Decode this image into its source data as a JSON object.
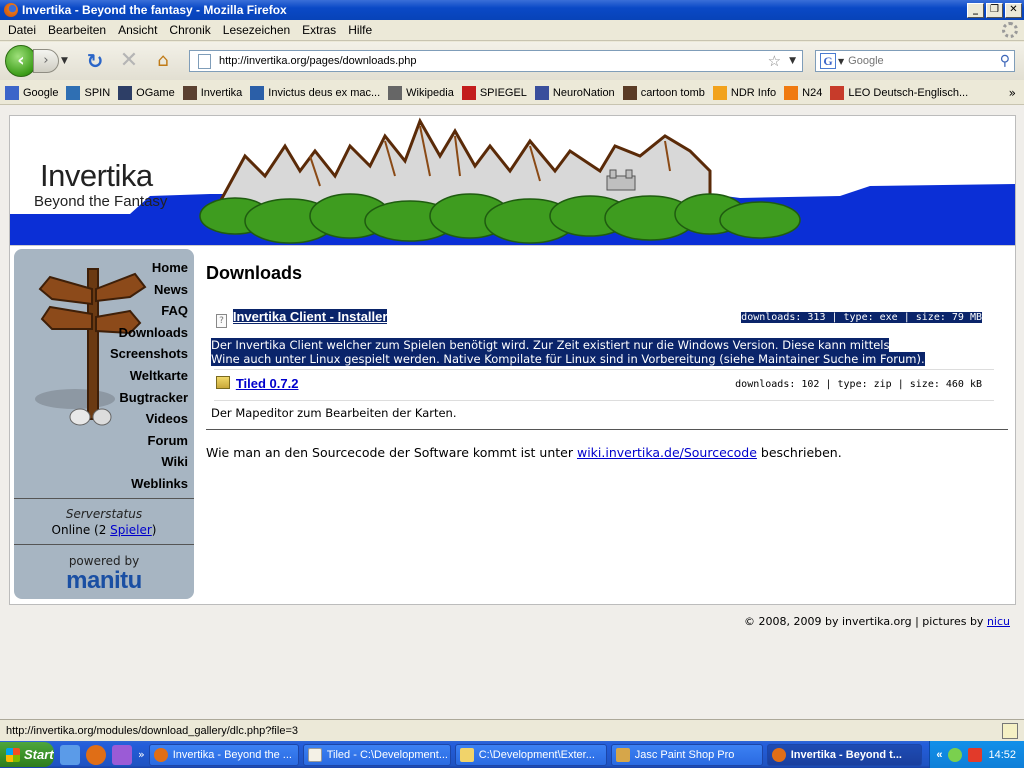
{
  "window": {
    "title": "Invertika - Beyond the fantasy - Mozilla Firefox",
    "buttons": [
      "_",
      "❐",
      "✕"
    ]
  },
  "menu": [
    "Datei",
    "Bearbeiten",
    "Ansicht",
    "Chronik",
    "Lesezeichen",
    "Extras",
    "Hilfe"
  ],
  "toolbar": {
    "url": "http://invertika.org/pages/downloads.php",
    "search_placeholder": "Google"
  },
  "bookmarks": [
    {
      "label": "Google",
      "color": "#3c65c9"
    },
    {
      "label": "SPIN",
      "color": "#2f6fb3"
    },
    {
      "label": "OGame",
      "color": "#2d3e66"
    },
    {
      "label": "Invertika",
      "color": "#5a4030"
    },
    {
      "label": "Invictus deus ex mac...",
      "color": "#2b5fa8"
    },
    {
      "label": "Wikipedia",
      "color": "#666666"
    },
    {
      "label": "SPIEGEL",
      "color": "#c31c1c"
    },
    {
      "label": "NeuroNation",
      "color": "#3a4f9c"
    },
    {
      "label": "cartoon tomb",
      "color": "#5a3b25"
    },
    {
      "label": "NDR Info",
      "color": "#f2a21b"
    },
    {
      "label": "N24",
      "color": "#f07a10"
    },
    {
      "label": "LEO Deutsch-Englisch...",
      "color": "#c73b2a"
    }
  ],
  "site": {
    "logo_title": "Invertika",
    "logo_subtitle": "Beyond the Fantasy",
    "nav": [
      "Home",
      "News",
      "FAQ",
      "Downloads",
      "Screenshots",
      "Weltkarte",
      "Bugtracker",
      "Videos",
      "Forum",
      "Wiki",
      "Weblinks"
    ],
    "serverstatus_title": "Serverstatus",
    "serverstatus_prefix": "Online (2 ",
    "serverstatus_link": "Spieler",
    "serverstatus_suffix": ")",
    "powered_by": "powered by",
    "powered_brand": "manitu"
  },
  "main": {
    "heading": "Downloads",
    "downloads": [
      {
        "title": "Invertika Client - Installer",
        "meta": "downloads: 313 | type: exe | size: 79 MB",
        "description_line1": "Der Invertika Client welcher zum Spielen benötigt wird. Zur Zeit existiert nur die Windows Version. Diese kann mittels",
        "description_line2": "Wine auch unter Linux gespielt werden. Native Kompilate für Linux sind in Vorbereitung (siehe Maintainer Suche im Forum).",
        "selected": true
      },
      {
        "title": "Tiled 0.7.2",
        "meta": "downloads: 102 | type: zip | size: 460 kB",
        "description_line1": "Der Mapeditor zum Bearbeiten der Karten.",
        "selected": false
      }
    ],
    "sourcecode_prefix": "Wie man an den Sourcecode der Software kommt ist unter ",
    "sourcecode_link": "wiki.invertika.de/Sourcecode",
    "sourcecode_suffix": " beschrieben."
  },
  "footer": {
    "text": "© 2008, 2009 by invertika.org | pictures by ",
    "link": "nicu"
  },
  "statusbar": {
    "text": "http://invertika.org/modules/download_gallery/dlc.php?file=3"
  },
  "taskbar": {
    "start": "Start",
    "more": "»",
    "tasks": [
      {
        "label": "Invertika - Beyond the ...",
        "active": false
      },
      {
        "label": "Tiled - C:\\Development...",
        "active": false
      },
      {
        "label": "C:\\Development\\Exter...",
        "active": false
      },
      {
        "label": "Jasc Paint Shop Pro",
        "active": false
      },
      {
        "label": "Invertika - Beyond t...",
        "active": true
      }
    ],
    "tray_expand": "«",
    "clock": "14:52"
  }
}
